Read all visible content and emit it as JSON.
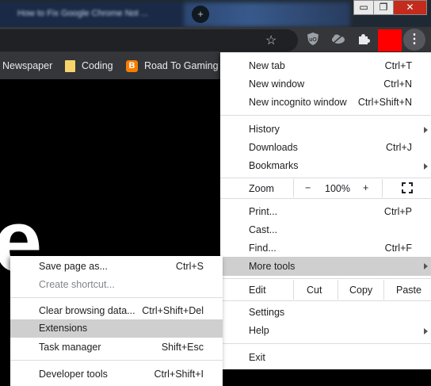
{
  "colors": {
    "menu_bg": "#ffffff",
    "highlight": "#cfcfcf",
    "toolbar": "#35363a",
    "omnibox": "#202124",
    "titlebar": "#1f2933",
    "close_button": "#c42b1c",
    "extension_red": "#ff0000"
  },
  "titlebar": {
    "tab_title": "How to Fix Google Chrome Not ...",
    "new_tab_glyph": "+",
    "minimize": "▭",
    "maximize": "❐",
    "close": "✕"
  },
  "toolbar": {
    "star_icon": "star-icon",
    "extensions": [
      "ublock-origin-icon",
      "cloud-eye-icon",
      "puzzle-icon",
      "red-extension-icon"
    ],
    "menu_glyph": "⋮"
  },
  "bookmarks": [
    {
      "label": "Newspaper",
      "icon": "none"
    },
    {
      "label": "Coding",
      "icon": "folder-icon"
    },
    {
      "label": "Road To Gaming L",
      "icon": "blogger-icon"
    }
  ],
  "page": {
    "big_letter": "e"
  },
  "menu": {
    "new_tab": {
      "label": "New tab",
      "shortcut": "Ctrl+T"
    },
    "new_window": {
      "label": "New window",
      "shortcut": "Ctrl+N"
    },
    "new_incognito": {
      "label": "New incognito window",
      "shortcut": "Ctrl+Shift+N"
    },
    "history": {
      "label": "History"
    },
    "downloads": {
      "label": "Downloads",
      "shortcut": "Ctrl+J"
    },
    "bookmarks": {
      "label": "Bookmarks"
    },
    "zoom": {
      "label": "Zoom",
      "minus": "−",
      "value": "100%",
      "plus": "+"
    },
    "print": {
      "label": "Print...",
      "shortcut": "Ctrl+P"
    },
    "cast": {
      "label": "Cast..."
    },
    "find": {
      "label": "Find...",
      "shortcut": "Ctrl+F"
    },
    "more_tools": {
      "label": "More tools"
    },
    "edit": {
      "label": "Edit",
      "cut": "Cut",
      "copy": "Copy",
      "paste": "Paste"
    },
    "settings": {
      "label": "Settings"
    },
    "help": {
      "label": "Help"
    },
    "exit": {
      "label": "Exit"
    }
  },
  "submenu": {
    "save_page": {
      "label": "Save page as...",
      "shortcut": "Ctrl+S"
    },
    "create_shortcut": {
      "label": "Create shortcut..."
    },
    "clear_data": {
      "label": "Clear browsing data...",
      "shortcut": "Ctrl+Shift+Del"
    },
    "extensions": {
      "label": "Extensions"
    },
    "task_manager": {
      "label": "Task manager",
      "shortcut": "Shift+Esc"
    },
    "dev_tools": {
      "label": "Developer tools",
      "shortcut": "Ctrl+Shift+I"
    }
  }
}
